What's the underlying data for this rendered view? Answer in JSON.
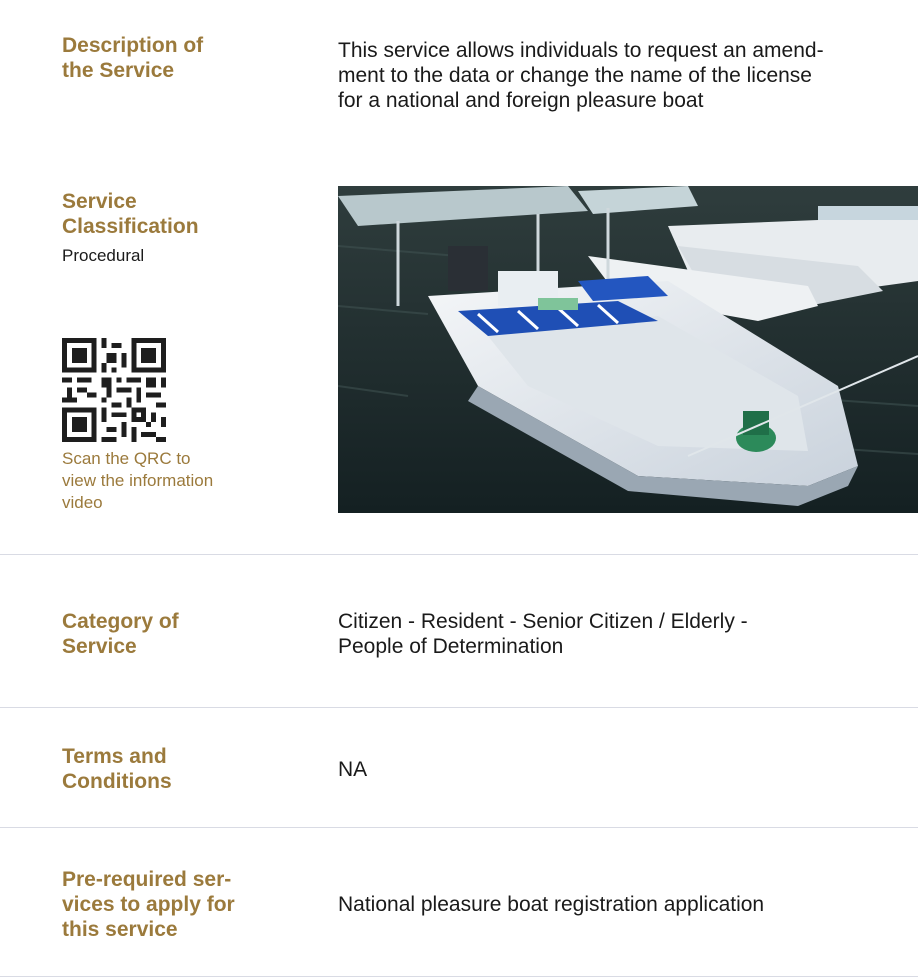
{
  "description": {
    "label_lines": [
      "Description of",
      "the Service"
    ],
    "text_lines": [
      "This service allows individuals to request an amend-",
      "ment to the data or change the name of the license",
      "for a national and foreign pleasure boat"
    ]
  },
  "classification": {
    "label_lines": [
      "Service",
      "Classification"
    ],
    "value": "Procedural"
  },
  "qr": {
    "icon": "qr-code-icon",
    "caption_lines": [
      "Scan the QRC to",
      "view the information",
      "video"
    ]
  },
  "photo": {
    "subject": "boat-photo"
  },
  "category": {
    "label_lines": [
      "Category of",
      "Service"
    ],
    "text_lines": [
      "Citizen - Resident - Senior Citizen / Elderly -",
      "People of Determination"
    ]
  },
  "terms": {
    "label_lines": [
      "Terms and",
      "Conditions"
    ],
    "value": "NA"
  },
  "prerequired": {
    "label_lines": [
      "Pre-required ser-",
      "vices to apply for",
      "this service"
    ],
    "value": "National pleasure boat registration application"
  },
  "colors": {
    "label": "#9b7a3c",
    "text": "#1a1a1a",
    "divider": "#d9dbe4"
  }
}
